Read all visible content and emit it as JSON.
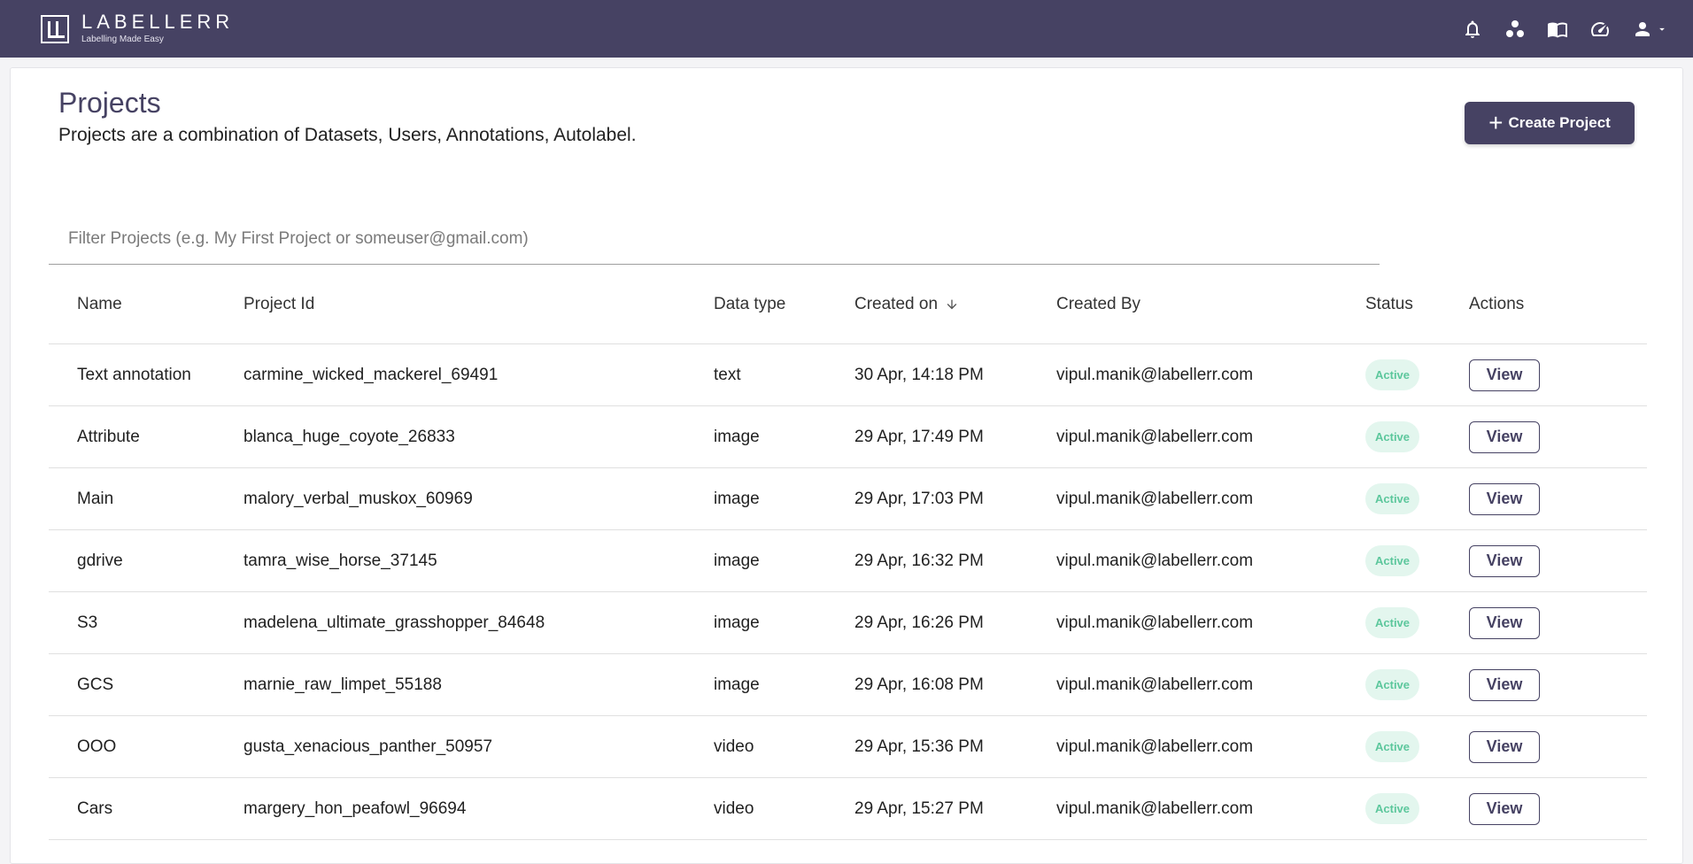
{
  "app": {
    "brand_name": "LABELLERR",
    "brand_tagline": "Labelling Made Easy"
  },
  "topbar": {
    "icons": [
      "bell-icon",
      "apps-icon",
      "book-icon",
      "speedometer-icon",
      "user-icon",
      "caret-down-icon"
    ]
  },
  "page": {
    "title": "Projects",
    "subtitle": "Projects are a combination of Datasets, Users, Annotations, Autolabel.",
    "create_button": "Create Project"
  },
  "filter": {
    "placeholder": "Filter Projects (e.g. My First Project or someuser@gmail.com)",
    "value": ""
  },
  "table": {
    "headers": {
      "name": "Name",
      "project_id": "Project Id",
      "data_type": "Data type",
      "created_on": "Created on",
      "created_by": "Created By",
      "status": "Status",
      "actions": "Actions"
    },
    "rows": [
      {
        "name": "Text annotation",
        "project_id": "carmine_wicked_mackerel_69491",
        "data_type": "text",
        "created_on": "30 Apr, 14:18 PM",
        "created_by": "vipul.manik@labellerr.com",
        "status": "Active",
        "action": "View"
      },
      {
        "name": "Attribute",
        "project_id": "blanca_huge_coyote_26833",
        "data_type": "image",
        "created_on": "29 Apr, 17:49 PM",
        "created_by": "vipul.manik@labellerr.com",
        "status": "Active",
        "action": "View"
      },
      {
        "name": "Main",
        "project_id": "malory_verbal_muskox_60969",
        "data_type": "image",
        "created_on": "29 Apr, 17:03 PM",
        "created_by": "vipul.manik@labellerr.com",
        "status": "Active",
        "action": "View"
      },
      {
        "name": "gdrive",
        "project_id": "tamra_wise_horse_37145",
        "data_type": "image",
        "created_on": "29 Apr, 16:32 PM",
        "created_by": "vipul.manik@labellerr.com",
        "status": "Active",
        "action": "View"
      },
      {
        "name": "S3",
        "project_id": "madelena_ultimate_grasshopper_84648",
        "data_type": "image",
        "created_on": "29 Apr, 16:26 PM",
        "created_by": "vipul.manik@labellerr.com",
        "status": "Active",
        "action": "View"
      },
      {
        "name": "GCS",
        "project_id": "marnie_raw_limpet_55188",
        "data_type": "image",
        "created_on": "29 Apr, 16:08 PM",
        "created_by": "vipul.manik@labellerr.com",
        "status": "Active",
        "action": "View"
      },
      {
        "name": "OOO",
        "project_id": "gusta_xenacious_panther_50957",
        "data_type": "video",
        "created_on": "29 Apr, 15:36 PM",
        "created_by": "vipul.manik@labellerr.com",
        "status": "Active",
        "action": "View"
      },
      {
        "name": "Cars",
        "project_id": "margery_hon_peafowl_96694",
        "data_type": "video",
        "created_on": "29 Apr, 15:27 PM",
        "created_by": "vipul.manik@labellerr.com",
        "status": "Active",
        "action": "View"
      }
    ]
  },
  "colors": {
    "brand": "#464263",
    "status_active_bg": "#e3f6ee",
    "status_active_text": "#5cc79c"
  }
}
